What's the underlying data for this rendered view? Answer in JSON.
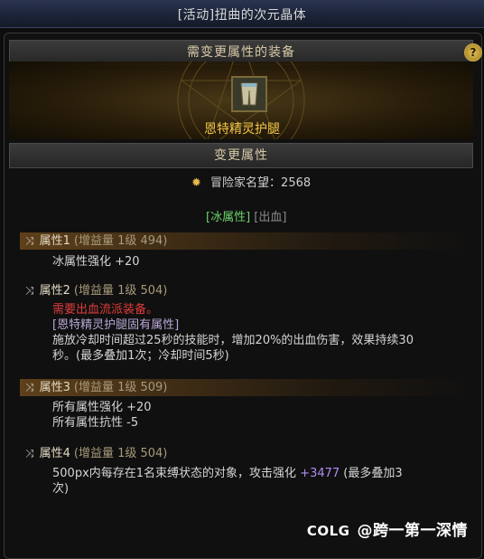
{
  "window": {
    "title": "[活动]扭曲的次元晶体"
  },
  "equip_section": {
    "header": "需变更属性的装备",
    "help": "?"
  },
  "item": {
    "name": "恩特精灵护腿"
  },
  "change_section": {
    "header": "变更属性"
  },
  "fame": {
    "label": "冒险家名望：2568"
  },
  "element_tabs": {
    "active": "[冰属性]",
    "inactive": "[出血]"
  },
  "attributes": [
    {
      "name": "属性1",
      "detail": "(增益量 1级 494)",
      "lines": [
        "冰属性强化 +20"
      ]
    },
    {
      "name": "属性2",
      "detail": "(增益量 1级 504)",
      "warning": "需要出血流派装备。",
      "lines": [
        "[恩特精灵护腿固有属性]",
        "施放冷却时间超过25秒的技能时，增加20%的出血伤害，效果持续30",
        "秒。(最多叠加1次；冷却时间5秒)"
      ]
    },
    {
      "name": "属性3",
      "detail": "(增益量 1级 509)",
      "lines": [
        "所有属性强化 +20",
        "所有属性抗性 -5"
      ]
    },
    {
      "name": "属性4",
      "detail": "(增益量 1级 504)",
      "line1_prefix": "500px内每存在1名束缚状态的对象，攻击强化 ",
      "line1_value": "+3477",
      "line1_suffix": " (最多叠加3",
      "line2": "次)"
    }
  ],
  "watermark": {
    "logo": "COLG",
    "text": "@跨一第一深情"
  }
}
